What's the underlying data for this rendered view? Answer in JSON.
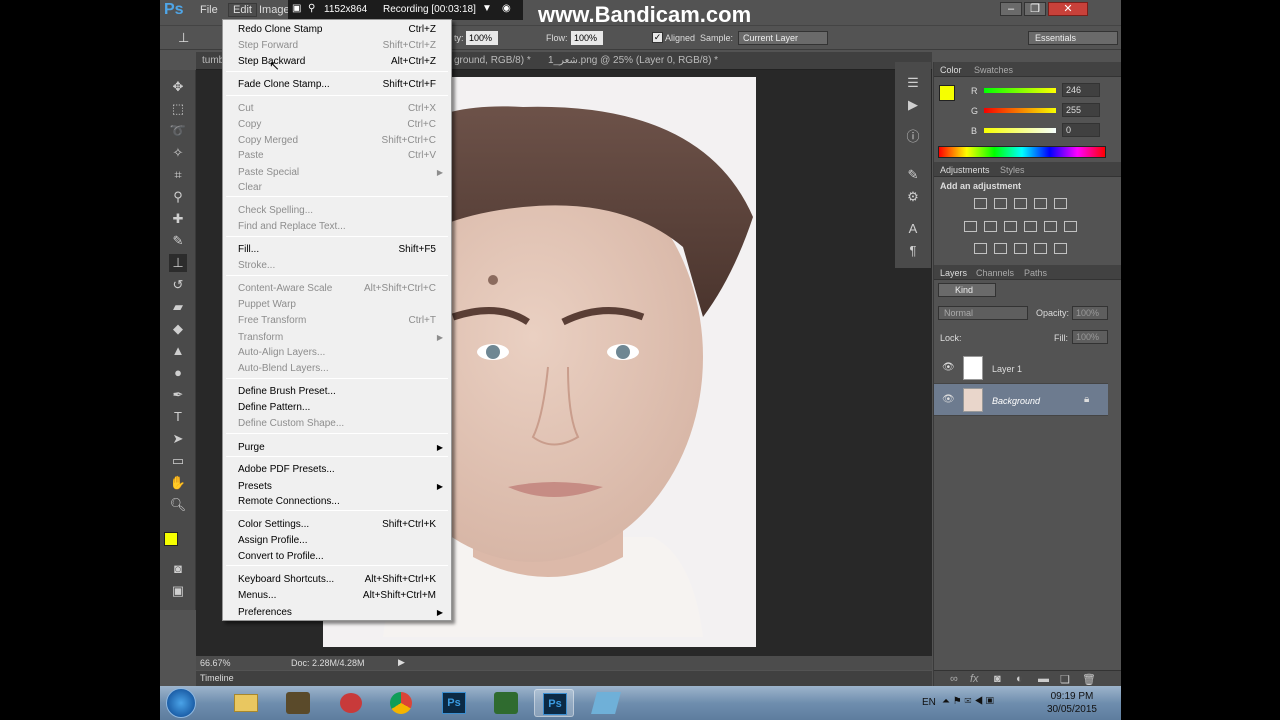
{
  "app": {
    "logo": "Ps",
    "menus": [
      "File",
      "Edit",
      "Image"
    ],
    "workspace": "Essentials"
  },
  "recording": {
    "resolution": "1152x864",
    "status": "Recording [00:03:18]"
  },
  "watermark": "www.Bandicam.com",
  "options_bar": {
    "opacity_label": "ty:",
    "opacity": "100%",
    "flow_label": "Flow:",
    "flow": "100%",
    "aligned_label": "Aligned",
    "sample_label": "Sample:",
    "sample_value": "Current Layer"
  },
  "doc_tabs": [
    {
      "label": "tumbl"
    },
    {
      "label": "ground, RGB/8) *"
    },
    {
      "label": "1_شعر.png @ 25% (Layer 0, RGB/8) *"
    }
  ],
  "status_bar": {
    "zoom": "66.67%",
    "doc": "Doc: 2.28M/4.28M"
  },
  "timeline_label": "Timeline",
  "color_panel": {
    "tabs": [
      "Color",
      "Swatches"
    ],
    "channels": [
      {
        "label": "R",
        "value": "246"
      },
      {
        "label": "G",
        "value": "255"
      },
      {
        "label": "B",
        "value": "0"
      }
    ],
    "foreground": "#f6ff00"
  },
  "adjustments_panel": {
    "tabs": [
      "Adjustments",
      "Styles"
    ],
    "title": "Add an adjustment"
  },
  "layers_panel": {
    "tabs": [
      "Layers",
      "Channels",
      "Paths"
    ],
    "kind_label": "Kind",
    "blend_mode": "Normal",
    "opacity_label": "Opacity:",
    "opacity": "100%",
    "lock_label": "Lock:",
    "fill_label": "Fill:",
    "fill": "100%",
    "layers": [
      {
        "name": "Layer 1",
        "selected": false
      },
      {
        "name": "Background",
        "selected": true
      }
    ]
  },
  "edit_menu": {
    "items": [
      {
        "label": "Redo Clone Stamp",
        "shortcut": "Ctrl+Z",
        "enabled": true
      },
      {
        "label": "Step Forward",
        "shortcut": "Shift+Ctrl+Z",
        "enabled": false
      },
      {
        "label": "Step Backward",
        "shortcut": "Alt+Ctrl+Z",
        "enabled": true
      },
      {
        "label": "Fade Clone Stamp...",
        "shortcut": "Shift+Ctrl+F",
        "enabled": true
      },
      {
        "label": "Cut",
        "shortcut": "Ctrl+X",
        "enabled": false
      },
      {
        "label": "Copy",
        "shortcut": "Ctrl+C",
        "enabled": false
      },
      {
        "label": "Copy Merged",
        "shortcut": "Shift+Ctrl+C",
        "enabled": false
      },
      {
        "label": "Paste",
        "shortcut": "Ctrl+V",
        "enabled": false
      },
      {
        "label": "Paste Special",
        "shortcut": "",
        "enabled": false
      },
      {
        "label": "Clear",
        "shortcut": "",
        "enabled": false
      },
      {
        "label": "Check Spelling...",
        "shortcut": "",
        "enabled": false
      },
      {
        "label": "Find and Replace Text...",
        "shortcut": "",
        "enabled": false
      },
      {
        "label": "Fill...",
        "shortcut": "Shift+F5",
        "enabled": true
      },
      {
        "label": "Stroke...",
        "shortcut": "",
        "enabled": false
      },
      {
        "label": "Content-Aware Scale",
        "shortcut": "Alt+Shift+Ctrl+C",
        "enabled": false
      },
      {
        "label": "Puppet Warp",
        "shortcut": "",
        "enabled": false
      },
      {
        "label": "Free Transform",
        "shortcut": "Ctrl+T",
        "enabled": false
      },
      {
        "label": "Transform",
        "shortcut": "",
        "enabled": false
      },
      {
        "label": "Auto-Align Layers...",
        "shortcut": "",
        "enabled": false
      },
      {
        "label": "Auto-Blend Layers...",
        "shortcut": "",
        "enabled": false
      },
      {
        "label": "Define Brush Preset...",
        "shortcut": "",
        "enabled": true
      },
      {
        "label": "Define Pattern...",
        "shortcut": "",
        "enabled": true
      },
      {
        "label": "Define Custom Shape...",
        "shortcut": "",
        "enabled": false
      },
      {
        "label": "Purge",
        "shortcut": "",
        "enabled": true
      },
      {
        "label": "Adobe PDF Presets...",
        "shortcut": "",
        "enabled": true
      },
      {
        "label": "Presets",
        "shortcut": "",
        "enabled": true
      },
      {
        "label": "Remote Connections...",
        "shortcut": "",
        "enabled": true
      },
      {
        "label": "Color Settings...",
        "shortcut": "Shift+Ctrl+K",
        "enabled": true
      },
      {
        "label": "Assign Profile...",
        "shortcut": "",
        "enabled": true
      },
      {
        "label": "Convert to Profile...",
        "shortcut": "",
        "enabled": true
      },
      {
        "label": "Keyboard Shortcuts...",
        "shortcut": "Alt+Shift+Ctrl+K",
        "enabled": true
      },
      {
        "label": "Menus...",
        "shortcut": "Alt+Shift+Ctrl+M",
        "enabled": true
      },
      {
        "label": "Preferences",
        "shortcut": "",
        "enabled": true
      }
    ]
  },
  "taskbar": {
    "language": "EN",
    "time": "09:19 PM",
    "date": "30/05/2015"
  }
}
